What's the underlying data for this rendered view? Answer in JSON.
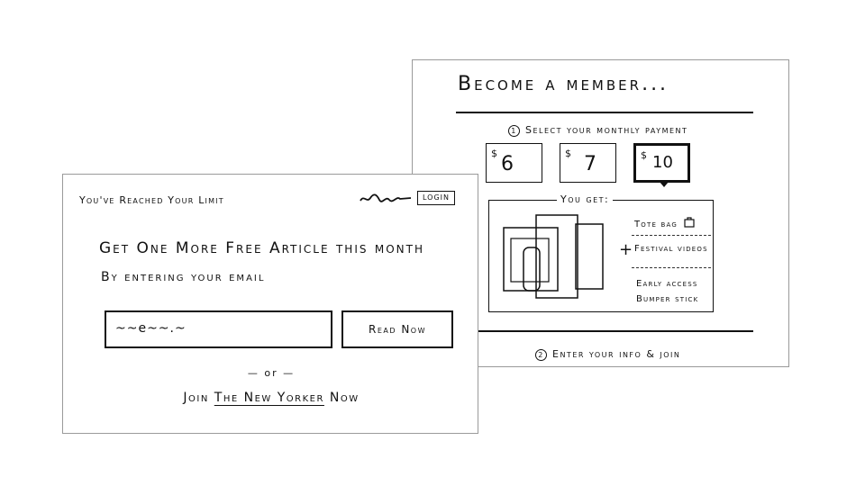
{
  "member": {
    "title": "Become a member...",
    "step1_num": "1",
    "step1_label": "Select your monthly payment",
    "prices": [
      {
        "currency": "$",
        "amount": "6",
        "selected": false
      },
      {
        "currency": "$",
        "amount": "7",
        "selected": false
      },
      {
        "currency": "$",
        "amount": "10",
        "selected": true
      }
    ],
    "you_get_label": "You get:",
    "benefits": [
      "Tote bag",
      "Festival videos",
      "Early access",
      "Bumper stick"
    ],
    "plus": "+",
    "step2_num": "2",
    "step2_label": "Enter your info & join"
  },
  "limit": {
    "heading": "You've Reached Your Limit",
    "login_label": "LOGIN",
    "offer_line1": "Get One More Free Article this month",
    "offer_line2": "By entering your email",
    "email_value": "~~e~~.~",
    "read_now_label": "Read Now",
    "or_label": "— or —",
    "join_prefix": "Join",
    "join_brand": "The New Yorker",
    "join_suffix": "Now"
  }
}
